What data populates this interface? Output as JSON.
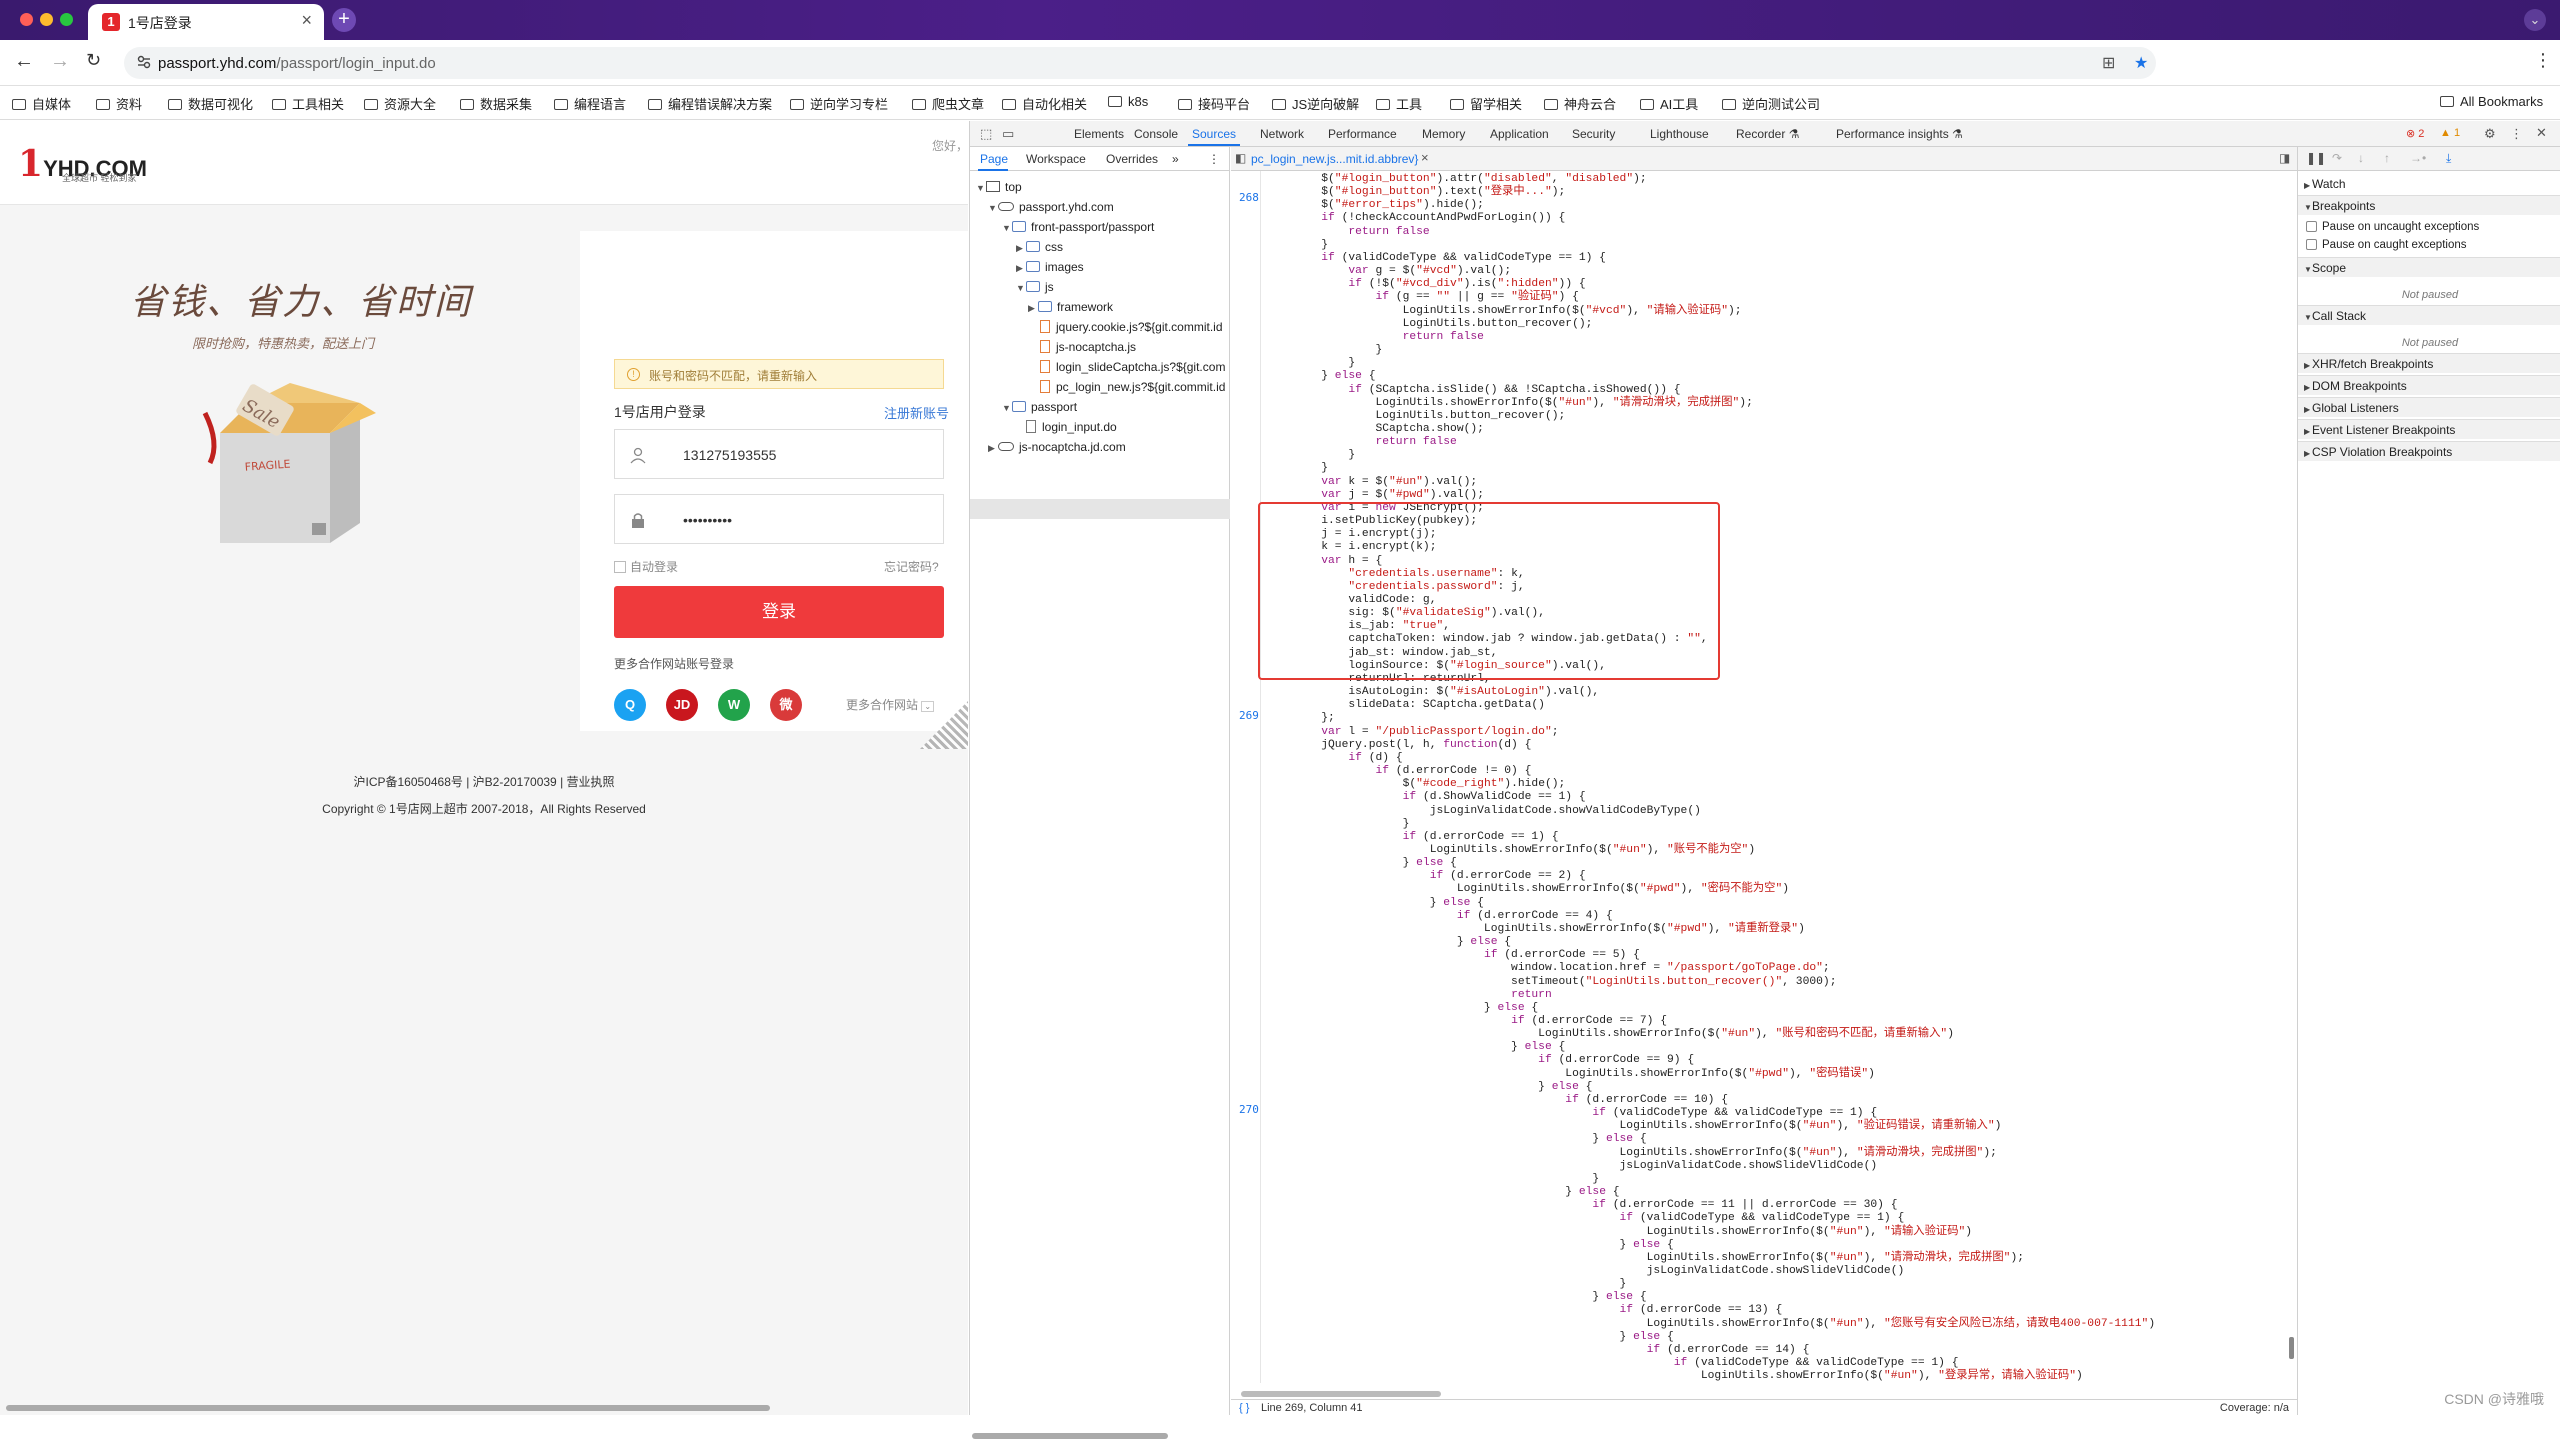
{
  "browser": {
    "tab_title": "1号店登录",
    "tab_favicon": "1",
    "url_host": "passport.yhd.com",
    "url_path": "/passport/login_input.do",
    "bookmarks": [
      "自媒体",
      "资料",
      "数据可视化",
      "工具相关",
      "资源大全",
      "数据采集",
      "编程语言",
      "编程错误解决方案",
      "逆向学习专栏",
      "爬虫文章",
      "自动化相关",
      "k8s",
      "接码平台",
      "JS逆向破解",
      "工具",
      "留学相关",
      "神舟云合",
      "AI工具",
      "逆向测试公司"
    ],
    "all_bookmarks": "All Bookmarks"
  },
  "page": {
    "logo_text": "YHD.COM",
    "logo_one": "1",
    "logo_sub": "全球超市 轻松到家",
    "hello": "您好，",
    "slogan": "省钱、省力、省时间",
    "slogan_sub": "限时抢购，特惠热卖，配送上门",
    "box_sale": "Sale",
    "box_fragile": "FRAGILE",
    "tips": "账号和密码不匹配，请重新输入",
    "card_title": "1号店用户登录",
    "register": "注册新账号",
    "username_value": "131275193555",
    "password_value": "••••••••••",
    "auto_login": "自动登录",
    "forget": "忘记密码?",
    "login_button": "登录",
    "partner_title": "更多合作网站账号登录",
    "social": {
      "qq": "Q",
      "jd": "JD",
      "wechat": "W",
      "weibo": "微"
    },
    "more_partner": "更多合作网站",
    "footer1": "沪ICP备16050468号  |  沪B2-20170039  |  营业执照",
    "footer2": "Copyright © 1号店网上超市 2007-2018，All Rights Reserved"
  },
  "devtools": {
    "tabs": [
      "Elements",
      "Console",
      "Sources",
      "Network",
      "Performance",
      "Memory",
      "Application",
      "Security",
      "Lighthouse",
      "Recorder",
      "Performance insights"
    ],
    "error_count": "2",
    "warn_count": "1",
    "navigator_tabs": [
      "Page",
      "Workspace",
      "Overrides"
    ],
    "tree": [
      {
        "label": "top"
      },
      {
        "label": "passport.yhd.com"
      },
      {
        "label": "front-passport/passport"
      },
      {
        "label": "css"
      },
      {
        "label": "images"
      },
      {
        "label": "js"
      },
      {
        "label": "framework"
      },
      {
        "label": "jquery.cookie.js?${git.commit.id"
      },
      {
        "label": "js-nocaptcha.js"
      },
      {
        "label": "login_slideCaptcha.js?${git.com"
      },
      {
        "label": "pc_login_new.js?${git.commit.id"
      },
      {
        "label": "passport"
      },
      {
        "label": "login_input.do"
      },
      {
        "label": "js-nocaptcha.jd.com"
      }
    ],
    "editor_tab": "pc_login_new.js...mit.id.abbrev}",
    "line_numbers": {
      "a": "268",
      "b": "269",
      "c": "270"
    },
    "status_position": "Line 269, Column 41",
    "coverage": "Coverage: n/a",
    "debugger": {
      "watch": "Watch",
      "breakpoints": "Breakpoints",
      "pause_uncaught": "Pause on uncaught exceptions",
      "pause_caught": "Pause on caught exceptions",
      "scope": "Scope",
      "not_paused": "Not paused",
      "call_stack": "Call Stack",
      "xhr": "XHR/fetch Breakpoints",
      "dom": "DOM Breakpoints",
      "global": "Global Listeners",
      "event": "Event Listener Breakpoints",
      "csp": "CSP Violation Breakpoints"
    }
  },
  "watermark": "CSDN @诗雅哦"
}
